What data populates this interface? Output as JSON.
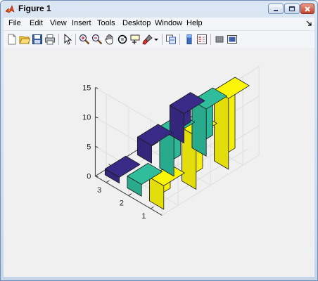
{
  "window": {
    "title": "Figure 1",
    "title_icon": "matlab-icon",
    "controls": [
      "minimize-icon",
      "maximize-icon",
      "close-icon"
    ]
  },
  "menubar": {
    "items": [
      "File",
      "Edit",
      "View",
      "Insert",
      "Tools",
      "Desktop",
      "Window",
      "Help"
    ],
    "dock_icon": "dock-arrow-icon"
  },
  "toolbar": {
    "buttons": [
      "new-figure-icon",
      "open-file-icon",
      "save-figure-icon",
      "print-figure-icon",
      "edit-plot-icon",
      "zoom-in-icon",
      "zoom-out-icon",
      "pan-icon",
      "rotate-3d-icon",
      "data-cursor-icon",
      "brush-icon",
      "brush-dropdown-icon",
      "link-plot-icon",
      "colorbar-icon",
      "legend-icon",
      "hide-plot-tools-icon",
      "show-plot-tools-icon"
    ]
  },
  "colors": {
    "yellow": "#fbf50c",
    "teal": "#2fbd9c",
    "navy": "#3a2a88"
  },
  "chart_data": {
    "type": "bar3",
    "title": "",
    "xlabel": "",
    "ylabel": "",
    "zlabel": "",
    "x_categories": [
      "1",
      "2",
      "3"
    ],
    "y_categories": [
      "1",
      "2",
      "3"
    ],
    "zlim": [
      0,
      15
    ],
    "z_ticks": [
      "0",
      "5",
      "10",
      "15"
    ],
    "grid": true,
    "series": [
      {
        "color": "yellow",
        "values": [
          4,
          9,
          12
        ]
      },
      {
        "color": "teal",
        "values": [
          2,
          7,
          8
        ]
      },
      {
        "color": "navy",
        "values": [
          1,
          3,
          5
        ]
      }
    ]
  }
}
